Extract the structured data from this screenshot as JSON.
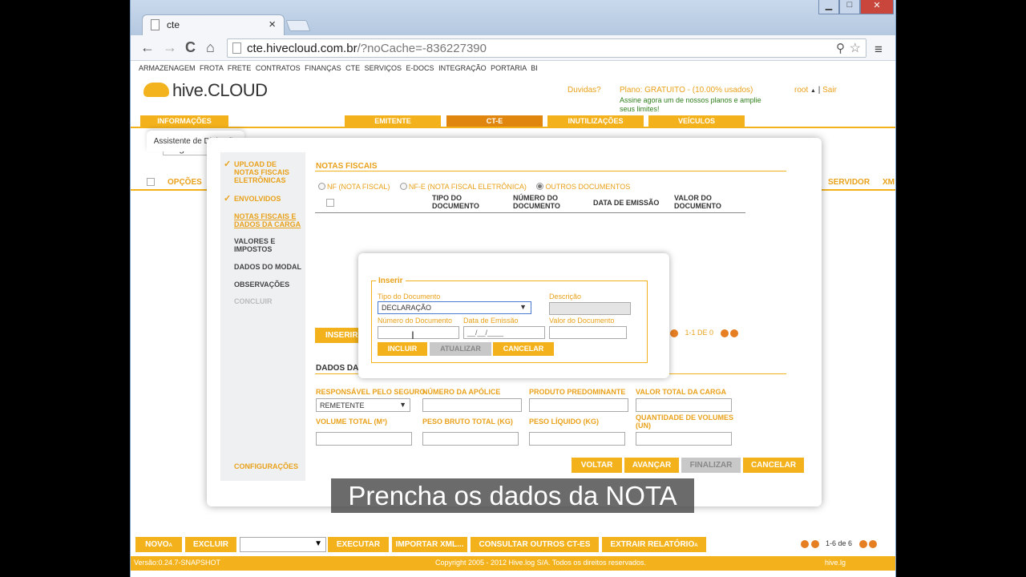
{
  "browser": {
    "tab_title": "cte",
    "tab_close": "×",
    "back": "←",
    "forward": "→",
    "reload": "C",
    "home": "⌂",
    "url_host": "cte.hivecloud.com.br",
    "url_path": "/?noCache=-836227390",
    "zoom_icon": "⚲",
    "star_icon": "☆",
    "menu_icon": "≡",
    "win_min": "▁",
    "win_max": "□",
    "win_close": "✕"
  },
  "app": {
    "top_menu": [
      "ARMAZENAGEM",
      "FROTA",
      "FRETE",
      "CONTRATOS",
      "FINANÇAS",
      "CTE",
      "SERVIÇOS",
      "E-DOCS",
      "INTEGRAÇÃO",
      "PORTARIA",
      "BI"
    ],
    "logo": "hive.CLOUD",
    "duvidas": "Duvidas?",
    "plano": "Plano: GRATUITO - (10.00% usados)",
    "assine": "Assine agora um de nossos planos e amplie seus limites!",
    "user": "root",
    "user_caret": "▲",
    "user_sep": "|",
    "sair": "Sair",
    "tabs": [
      "INFORMAÇÕES",
      "EMITENTE",
      "CT-E",
      "INUTILIZAÇÕES",
      "VEÍCULOS"
    ],
    "search_placeholder": "Digite ou",
    "list_header_opcoes": "OPÇÕES",
    "list_header_servidor": "SERVIDOR",
    "list_header_xm": "XM",
    "bottom_buttons": [
      "NOVO",
      "EXCLUIR",
      "EXECUTAR",
      "IMPORTAR XML...",
      "CONSULTAR OUTROS CT-ES",
      "EXTRAIR RELATÓRIO"
    ],
    "bottom_suffix": "A",
    "select_arrow": "▼",
    "pagination_bottom": "1-6 de 6",
    "version": "Versão:0.24.7-SNAPSHOT",
    "copyright": "Copyright 2005 - 2012 Hive.log S/A. Todos os direitos reservados.",
    "hivelog": "hive.lg"
  },
  "wizard": {
    "title": "Assistente de Digitação",
    "check": "✓",
    "steps": [
      {
        "label": "UPLOAD DE NOTAS FISCAIS ELETRÔNICAS",
        "done": true
      },
      {
        "label": "ENVOLVIDOS",
        "done": true
      },
      {
        "label": "NOTAS FISCAIS E DADOS DA CARGA",
        "done": false,
        "current": true
      },
      {
        "label": "VALORES E IMPOSTOS",
        "done": false
      },
      {
        "label": "DADOS DO MODAL",
        "done": false
      },
      {
        "label": "OBSERVAÇÕES",
        "done": false
      },
      {
        "label": "CONCLUIR",
        "done": false,
        "disabled": true
      }
    ],
    "config": "CONFIGURAÇÕES",
    "notas_heading": "NOTAS FISCAIS",
    "radio_nf": "NF (NOTA FISCAL)",
    "radio_nfe": "NF-E (NOTA FISCAL ELETRÔNICA)",
    "radio_outros": "OUTROS DOCUMENTOS",
    "selected_radio": "OUTROS DOCUMENTOS",
    "columns": [
      "TIPO DO DOCUMENTO",
      "NÚMERO DO DOCUMENTO",
      "DATA DE EMISSÃO",
      "VALOR DO DOCUMENTO"
    ],
    "inserir": "INSERIR",
    "pagination": "1-1 DE 0",
    "dados_heading": "DADOS DA",
    "labels": {
      "responsavel": "RESPONSÁVEL PELO SEGURO",
      "apolice": "NÚMERO DA APÓLICE",
      "produto": "PRODUTO PREDOMINANTE",
      "valor_total": "VALOR TOTAL DA CARGA",
      "volume": "VOLUME TOTAL (M³)",
      "peso_bruto": "PESO BRUTO TOTAL (KG)",
      "peso_liquido": "PESO LÍQUIDO (KG)",
      "qtd_volumes": "QUANTIDADE DE VOLUMES (UN)"
    },
    "responsavel_value": "REMETENTE",
    "buttons": {
      "voltar": "VOLTAR",
      "avancar": "AVANÇAR",
      "finalizar": "FINALIZAR",
      "cancelar": "CANCELAR"
    }
  },
  "insert_dialog": {
    "legend": "Inserir",
    "tipo_label": "Tipo do Documento",
    "tipo_value": "DECLARAÇÃO",
    "descricao_label": "Descrição",
    "numero_label": "Número do Documento",
    "data_label": "Data de Emissão",
    "data_mask": "__/__/____",
    "valor_label": "Valor do Documento",
    "incluir": "INCLUIR",
    "atualizar": "ATUALIZAR",
    "cancelar": "CANCELAR",
    "cursor": "I"
  },
  "caption": "Prencha os dados da NOTA"
}
